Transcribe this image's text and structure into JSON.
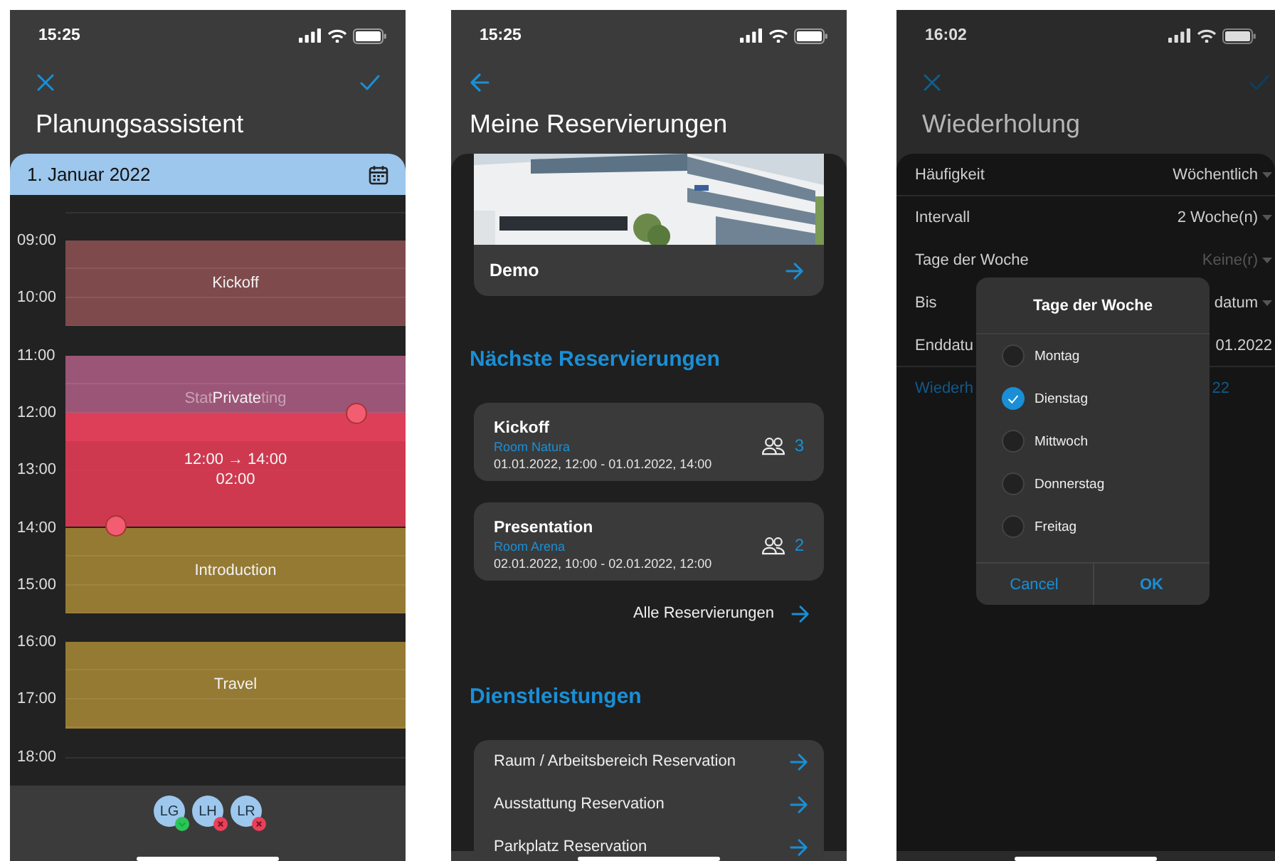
{
  "planner": {
    "status_time": "15:25",
    "title": "Planungsassistent",
    "date": "1. Januar 2022",
    "hours": [
      {
        "label": "09:00",
        "events": [
          {
            "kind": "ninety",
            "color": "#7f4a4c",
            "labels": [
              {
                "text": "Kickoff",
                "faint": false
              }
            ]
          }
        ]
      },
      {
        "label": "10:00"
      },
      {
        "label": "11:00",
        "events": [
          {
            "kind": "ninety",
            "color": "#9b5577",
            "labels": [
              {
                "text": "Stat",
                "faint": true
              },
              {
                "text": "Private",
                "faint": false
              },
              {
                "text": "ting",
                "faint": true
              }
            ]
          }
        ]
      },
      {
        "label": "12:00"
      },
      {
        "label": "13:00"
      },
      {
        "label": "14:00",
        "events": [
          {
            "kind": "ninety",
            "color": "#957a33",
            "labels": [
              {
                "text": "Introduction",
                "faint": false
              }
            ]
          }
        ]
      },
      {
        "label": "15:00"
      },
      {
        "label": "16:00",
        "events": [
          {
            "kind": "ninety",
            "color": "#957a33",
            "labels": [
              {
                "text": "Travel",
                "faint": false
              }
            ]
          }
        ]
      },
      {
        "label": "17:00"
      },
      {
        "label": "18:00"
      }
    ],
    "selection": {
      "range": "12:00 → 14:00",
      "duration": "02:00"
    },
    "attendees": [
      {
        "initials": "LG",
        "accepted": true
      },
      {
        "initials": "LH",
        "accepted": false
      },
      {
        "initials": "LR",
        "accepted": false
      }
    ]
  },
  "reservations": {
    "status_time": "15:25",
    "title": "Meine Reservierungen",
    "location": {
      "name": "Demo",
      "kind": "picture"
    },
    "upcoming_heading": "Nächste Reservierungen",
    "items": [
      {
        "title": "Kickoff",
        "room": "Room Natura",
        "time": "01.01.2022, 12:00 - 01.01.2022, 14:00",
        "attendees": "3"
      },
      {
        "title": "Presentation",
        "room": "Room Arena",
        "time": "02.01.2022, 10:00 - 02.01.2022, 12:00",
        "attendees": "2"
      }
    ],
    "all_link": "Alle Reservierungen",
    "services_heading": "Dienstleistungen",
    "services": [
      "Raum / Arbeitsbereich Reservation",
      "Ausstattung Reservation",
      "Parkplatz Reservation"
    ]
  },
  "repeat": {
    "status_time": "16:02",
    "title": "Wiederholung",
    "rows": [
      {
        "label": "Häufigkeit",
        "value": "Wöchentlich",
        "kind": "dropdown"
      },
      {
        "label": "Intervall",
        "value": "2 Woche(n)",
        "kind": "dropdown"
      },
      {
        "label": "Tage der Woche",
        "placeholder": "Keine(r)",
        "kind": "dropdown"
      },
      {
        "label": "Bis",
        "value": "datum",
        "kind": "dropdown"
      },
      {
        "label": "Enddatu",
        "value": "01.2022",
        "kind": "date"
      },
      {
        "label": "Wiederh",
        "value": "22",
        "kind": "link"
      }
    ],
    "dialog": {
      "title": "Tage der Woche",
      "options": [
        {
          "label": "Montag",
          "selected": false
        },
        {
          "label": "Dienstag",
          "selected": true
        },
        {
          "label": "Mittwoch",
          "selected": false
        },
        {
          "label": "Donnerstag",
          "selected": false
        },
        {
          "label": "Freitag",
          "selected": false
        }
      ],
      "buttons": [
        {
          "label": "Cancel",
          "kind": "cancel"
        },
        {
          "label": "OK",
          "kind": "confirm"
        }
      ]
    }
  }
}
